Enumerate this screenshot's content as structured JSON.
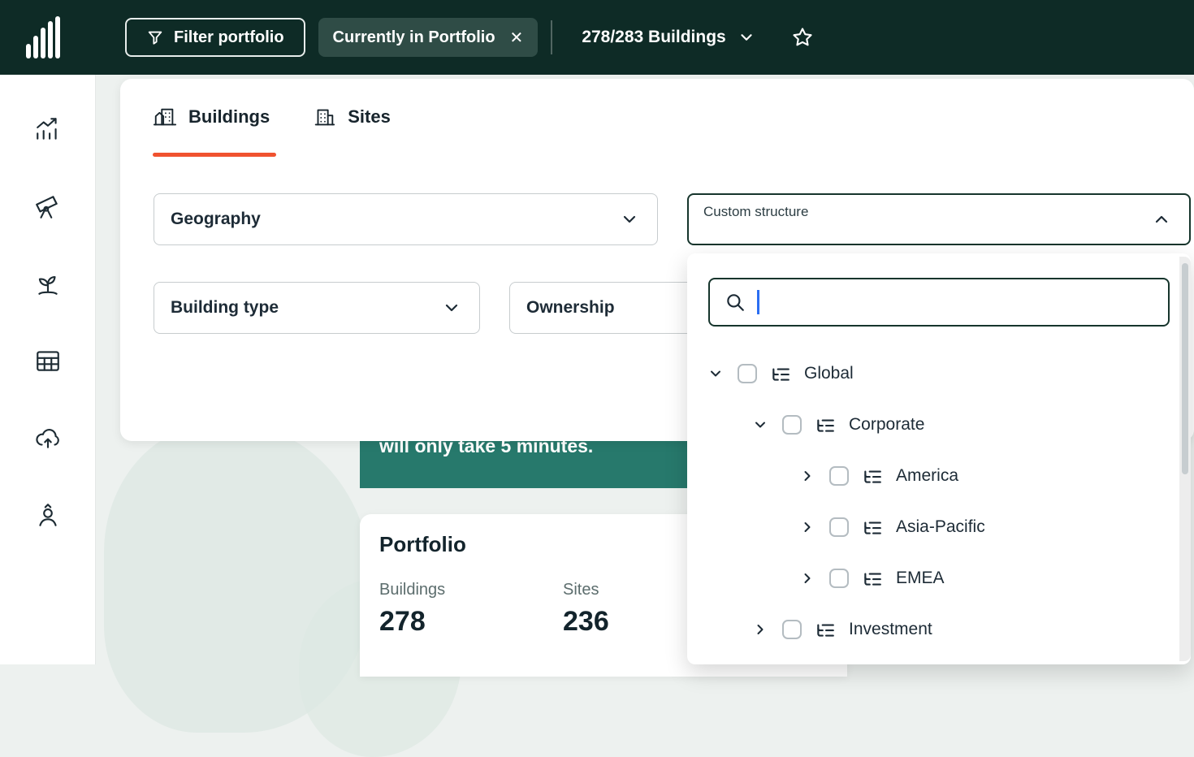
{
  "topbar": {
    "filter_label": "Filter portfolio",
    "chip_label": "Currently in Portfolio",
    "chip_close": "✕",
    "buildings_count": "278/283 Buildings"
  },
  "sidebar": {
    "items": [
      {
        "icon": "performance-chart-icon"
      },
      {
        "icon": "telescope-icon"
      },
      {
        "icon": "sustainability-icon"
      },
      {
        "icon": "table-icon"
      },
      {
        "icon": "cloud-upload-icon"
      },
      {
        "icon": "user-icon"
      }
    ]
  },
  "panel": {
    "tabs": [
      {
        "label": "Buildings",
        "active": true
      },
      {
        "label": "Sites",
        "active": false
      }
    ],
    "filters": {
      "geography": "Geography",
      "building_type": "Building type",
      "ownership": "Ownership",
      "custom_structure": "Custom structure"
    }
  },
  "custom_structure_dropdown": {
    "search_value": "",
    "tree": {
      "items": [
        {
          "label": "Global",
          "level": 0,
          "expanded": true,
          "checked": false
        },
        {
          "label": "Corporate",
          "level": 1,
          "expanded": true,
          "checked": false
        },
        {
          "label": "America",
          "level": 2,
          "expanded": false,
          "checked": false
        },
        {
          "label": "Asia-Pacific",
          "level": 2,
          "expanded": false,
          "checked": false
        },
        {
          "label": "EMEA",
          "level": 2,
          "expanded": false,
          "checked": false
        },
        {
          "label": "Investment",
          "level": 1,
          "expanded": false,
          "checked": false
        }
      ]
    }
  },
  "banner": {
    "text": "will only take 5 minutes."
  },
  "portfolio_card": {
    "title": "Portfolio",
    "stats": [
      {
        "label": "Buildings",
        "value": "278"
      },
      {
        "label": "Sites",
        "value": "236"
      }
    ]
  },
  "colors": {
    "topbar_bg": "#0e2b26",
    "accent_orange": "#f0522f",
    "banner_teal": "#27796c",
    "caret_blue": "#2b6ef2"
  }
}
